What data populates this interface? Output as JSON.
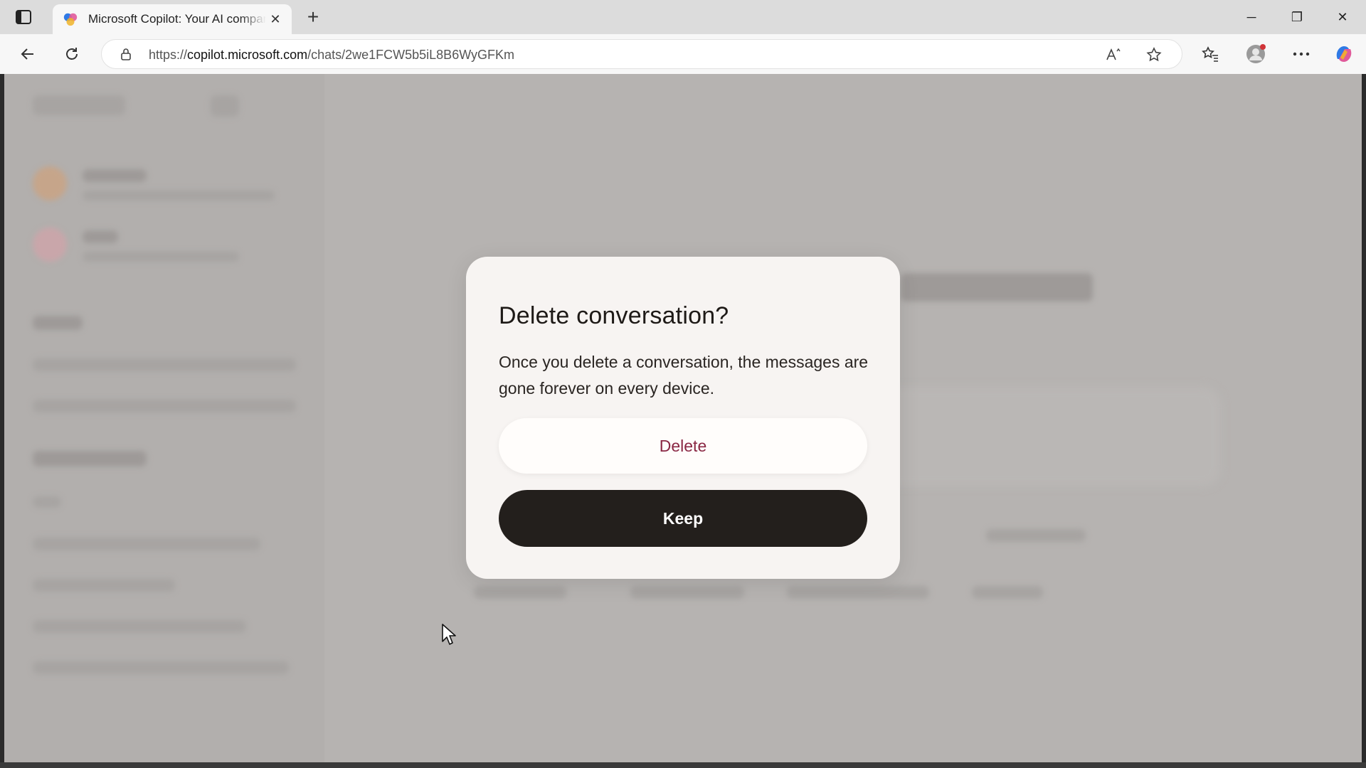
{
  "browser": {
    "tab_title": "Microsoft Copilot: Your AI companion",
    "tab_close_glyph": "✕",
    "new_tab_glyph": "+",
    "url_prefix": "https://",
    "url_host": "copilot.microsoft.com",
    "url_path": "/chats/2we1FCW5b5iL8B6WyGFKm",
    "window_controls": {
      "minimize": "─",
      "restore": "❐",
      "close": "✕"
    },
    "icons": [
      "sidebar-toggle-icon",
      "copilot-favicon",
      "back-icon",
      "refresh-icon",
      "lock-icon",
      "read-aloud-icon",
      "favorite-star-icon",
      "favorites-list-icon",
      "profile-icon",
      "more-icon",
      "copilot-icon"
    ]
  },
  "dialog": {
    "title": "Delete conversation?",
    "body": "Once you delete a conversation, the messages are gone forever on every device.",
    "delete_label": "Delete",
    "keep_label": "Keep"
  },
  "colors": {
    "overlay": "#b6b3b1",
    "dialog_bg": "#f7f4f2",
    "delete_text": "#8a2844",
    "keep_bg": "#231f1c"
  }
}
